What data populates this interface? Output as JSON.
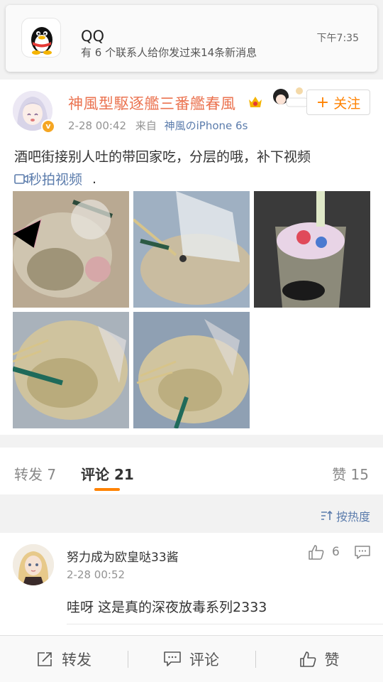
{
  "notification": {
    "app": "QQ",
    "message": "有 6 个联系人给你发过来14条新消息",
    "time": "下午7:35",
    "icon": "qq-penguin-icon"
  },
  "post": {
    "username": "神風型駆逐艦三番艦春風",
    "follow_label": "关注",
    "time": "2-28 00:42",
    "source_prefix": "来自",
    "device": "神風のiPhone 6s",
    "text": "酒吧街接别人吐的带回家吃，分层的哦，补下视频",
    "video_link": "秒拍视频",
    "trailing": ".",
    "image_count": 5
  },
  "tabs": {
    "repost": "转发 7",
    "comments": "评论 21",
    "likes": "赞 15"
  },
  "sort": {
    "label": "按热度"
  },
  "comment": {
    "username": "努力成为欧皇哒33酱",
    "time": "2-28 00:52",
    "text": "哇呀 这是真的深夜放毒系列2333",
    "like_count": "6"
  },
  "bottom_bar": {
    "repost": "转发",
    "comment": "评论",
    "like": "赞"
  },
  "colors": {
    "accent": "#ff8200",
    "username": "#eb7350",
    "link": "#5b7cac"
  }
}
